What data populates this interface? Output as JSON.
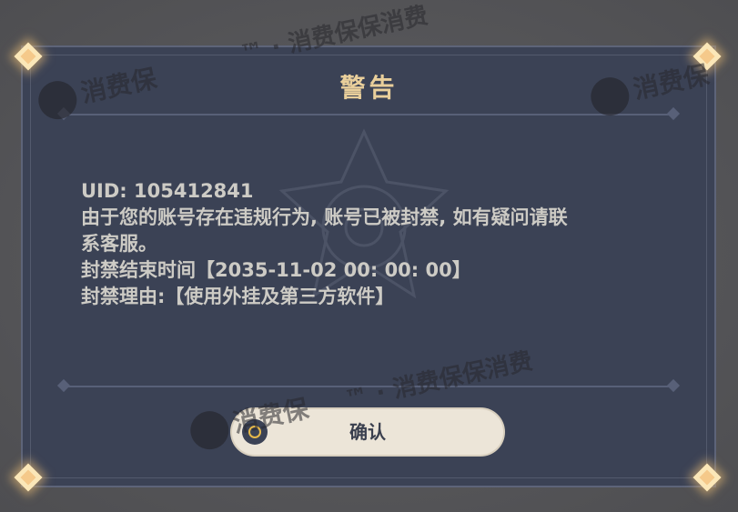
{
  "dialog": {
    "title": "警告",
    "message_lines": [
      "UID: 105412841",
      "由于您的账号存在违规行为, 账号已被封禁, 如有疑问请联",
      "系客服。",
      "封禁结束时间【2035-11-02 00: 00: 00】",
      "封禁理由:【使用外挂及第三方软件】"
    ],
    "confirm_label": "确认"
  },
  "watermarks": {
    "brand": "消费保",
    "tagline_top": "™ · 消费保保消费",
    "tagline_mid": "™ · 消费保保消费"
  },
  "colors": {
    "dialog_bg": "#3b4255",
    "title": "#e9cf9b",
    "button_bg": "#ece5d8",
    "icon_accent": "#e7b94a"
  }
}
